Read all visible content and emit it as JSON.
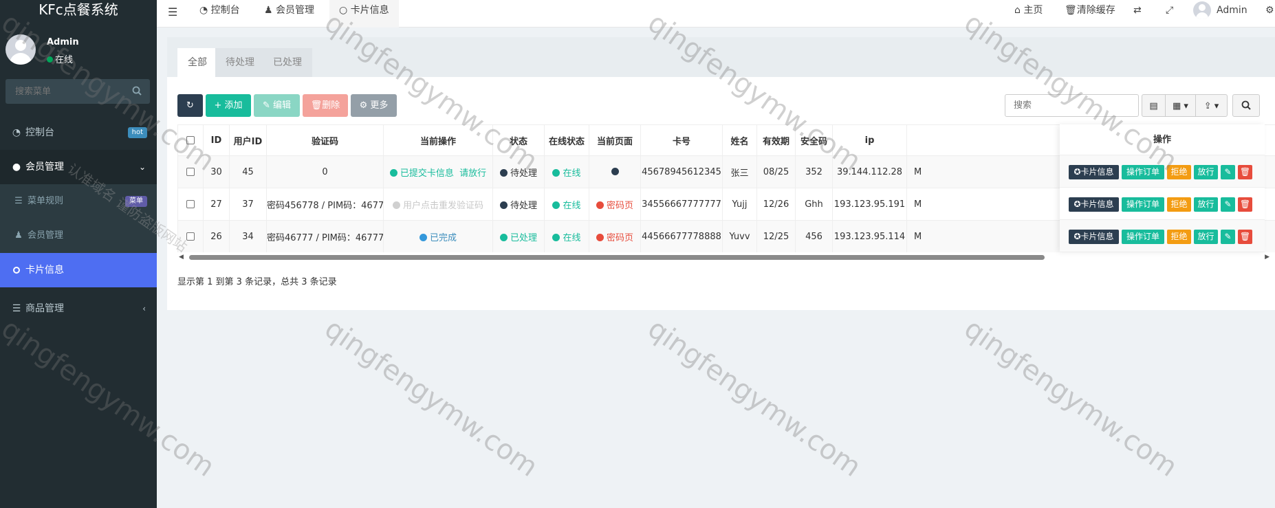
{
  "app": {
    "title": "KFc点餐系统"
  },
  "user": {
    "name": "Admin",
    "status": "在线"
  },
  "sidebar": {
    "search_placeholder": "搜索菜单",
    "items": [
      {
        "label": "控制台",
        "badge": "hot"
      },
      {
        "label": "会员管理"
      },
      {
        "label": "菜单规则",
        "badge": "菜单"
      },
      {
        "label": "会员管理"
      },
      {
        "label": "卡片信息"
      },
      {
        "label": "商品管理"
      }
    ]
  },
  "topbar": {
    "tabs": [
      "控制台",
      "会员管理",
      "卡片信息"
    ],
    "home": "主页",
    "clear_cache": "清除缓存",
    "user": "Admin"
  },
  "panel": {
    "tabs": [
      "全部",
      "待处理",
      "已处理"
    ],
    "toolbar": {
      "add": "添加",
      "edit": "编辑",
      "delete": "删除",
      "more": "更多"
    },
    "search_placeholder": "搜索"
  },
  "table": {
    "headers": [
      "ID",
      "用户ID",
      "验证码",
      "当前操作",
      "状态",
      "在线状态",
      "当前页面",
      "卡号",
      "姓名",
      "有效期",
      "安全码",
      "ip",
      "操作"
    ],
    "rows": [
      {
        "id": "30",
        "uid": "45",
        "code": "0",
        "op": "已提交卡信息",
        "op_link": "请放行",
        "status": "待处理",
        "online": "在线",
        "page": "",
        "card": "45678945612345",
        "name": "张三",
        "exp": "08/25",
        "cvv": "352",
        "ip": "39.144.112.28",
        "extra": "M"
      },
      {
        "id": "27",
        "uid": "37",
        "code": "密码456778 / PIM码：4677",
        "op": "用户点击重发验证码",
        "op_link": "",
        "status": "待处理",
        "online": "在线",
        "page": "密码页",
        "card": "34556667777777",
        "name": "Yujj",
        "exp": "12/26",
        "cvv": "Ghh",
        "ip": "193.123.95.191",
        "extra": "M"
      },
      {
        "id": "26",
        "uid": "34",
        "code": "密码46777 / PIM码：46777",
        "op": "已完成",
        "op_link": "",
        "status": "已处理",
        "online": "在线",
        "page": "密码页",
        "card": "44566677778888",
        "name": "Yuvv",
        "exp": "12/25",
        "cvv": "456",
        "ip": "193.123.95.114",
        "extra": "M"
      }
    ],
    "ops": {
      "card_info": "卡片信息",
      "order": "操作订单",
      "refuse": "拒绝",
      "pass": "放行"
    }
  },
  "pager": {
    "info": "显示第 1 到第 3 条记录，总共 3 条记录"
  },
  "watermark": {
    "text": "qingfengymw.com",
    "cn": "认准域名 谨防盗版网站"
  }
}
